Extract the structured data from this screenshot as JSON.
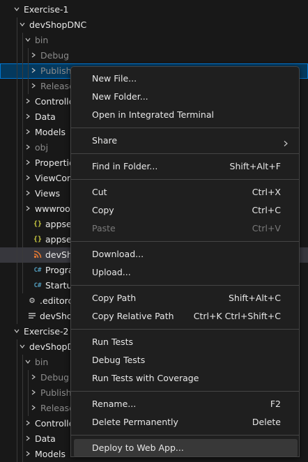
{
  "tree": {
    "rows": [
      {
        "label": "Exercise-1",
        "depth": 0,
        "chevron": "down",
        "style": "bright"
      },
      {
        "label": "devShopDNC",
        "depth": 1,
        "chevron": "down",
        "style": "bright"
      },
      {
        "label": "bin",
        "depth": 2,
        "chevron": "down",
        "style": "dim"
      },
      {
        "label": "Debug",
        "depth": 3,
        "chevron": "right",
        "style": "dim"
      },
      {
        "label": "Publish",
        "depth": 3,
        "chevron": "right",
        "style": "dim",
        "selected": true
      },
      {
        "label": "Release",
        "depth": 3,
        "chevron": "right",
        "style": "dim"
      },
      {
        "label": "Controllers",
        "depth": 2,
        "chevron": "right",
        "style": "bright"
      },
      {
        "label": "Data",
        "depth": 2,
        "chevron": "right",
        "style": "bright"
      },
      {
        "label": "Models",
        "depth": 2,
        "chevron": "right",
        "style": "bright"
      },
      {
        "label": "obj",
        "depth": 2,
        "chevron": "right",
        "style": "dim"
      },
      {
        "label": "Properties",
        "depth": 2,
        "chevron": "right",
        "style": "bright"
      },
      {
        "label": "ViewComponents",
        "depth": 2,
        "chevron": "right",
        "style": "bright"
      },
      {
        "label": "Views",
        "depth": 2,
        "chevron": "right",
        "style": "bright"
      },
      {
        "label": "wwwroot",
        "depth": 2,
        "chevron": "right",
        "style": "bright"
      },
      {
        "label": "appsettings.Development.json",
        "depth": 2,
        "icon": "json",
        "style": "bright"
      },
      {
        "label": "appsettings.json",
        "depth": 2,
        "icon": "json",
        "style": "bright"
      },
      {
        "label": "devShopDNC.csproj",
        "depth": 2,
        "icon": "rss",
        "style": "bright",
        "highlight": true
      },
      {
        "label": "Program.cs",
        "depth": 2,
        "icon": "csharp",
        "style": "bright"
      },
      {
        "label": "Startup.cs",
        "depth": 2,
        "icon": "csharp",
        "style": "bright"
      },
      {
        "label": ".editorconfig",
        "depth": 1,
        "icon": "gear",
        "style": "bright"
      },
      {
        "label": "devShopDNC.sln",
        "depth": 1,
        "icon": "lines",
        "style": "bright"
      },
      {
        "label": "Exercise-2",
        "depth": 0,
        "chevron": "down",
        "style": "bright"
      },
      {
        "label": "devShopDNC",
        "depth": 1,
        "chevron": "down",
        "style": "bright"
      },
      {
        "label": "bin",
        "depth": 2,
        "chevron": "down",
        "style": "dim"
      },
      {
        "label": "Debug",
        "depth": 3,
        "chevron": "right",
        "style": "dim"
      },
      {
        "label": "Publish",
        "depth": 3,
        "chevron": "right",
        "style": "dim"
      },
      {
        "label": "Release",
        "depth": 3,
        "chevron": "right",
        "style": "dim"
      },
      {
        "label": "Controllers",
        "depth": 2,
        "chevron": "right",
        "style": "bright"
      },
      {
        "label": "Data",
        "depth": 2,
        "chevron": "right",
        "style": "bright"
      },
      {
        "label": "Models",
        "depth": 2,
        "chevron": "right",
        "style": "bright"
      }
    ]
  },
  "context_menu": {
    "groups": [
      [
        {
          "label": "New File...",
          "shortcut": ""
        },
        {
          "label": "New Folder...",
          "shortcut": ""
        },
        {
          "label": "Open in Integrated Terminal",
          "shortcut": ""
        }
      ],
      [
        {
          "label": "Share",
          "shortcut": "",
          "submenu": true
        }
      ],
      [
        {
          "label": "Find in Folder...",
          "shortcut": "Shift+Alt+F"
        }
      ],
      [
        {
          "label": "Cut",
          "shortcut": "Ctrl+X"
        },
        {
          "label": "Copy",
          "shortcut": "Ctrl+C"
        },
        {
          "label": "Paste",
          "shortcut": "Ctrl+V",
          "disabled": true
        }
      ],
      [
        {
          "label": "Download...",
          "shortcut": ""
        },
        {
          "label": "Upload...",
          "shortcut": ""
        }
      ],
      [
        {
          "label": "Copy Path",
          "shortcut": "Shift+Alt+C"
        },
        {
          "label": "Copy Relative Path",
          "shortcut": "Ctrl+K Ctrl+Shift+C"
        }
      ],
      [
        {
          "label": "Run Tests",
          "shortcut": ""
        },
        {
          "label": "Debug Tests",
          "shortcut": ""
        },
        {
          "label": "Run Tests with Coverage",
          "shortcut": ""
        }
      ],
      [
        {
          "label": "Rename...",
          "shortcut": "F2"
        },
        {
          "label": "Delete Permanently",
          "shortcut": "Delete"
        }
      ],
      [
        {
          "label": "Deploy to Web App...",
          "shortcut": "",
          "active": true
        }
      ]
    ]
  },
  "colors": {
    "background": "#181818",
    "selection": "#04395e",
    "selection_border": "#0078d4",
    "json_icon": "#cbcb41",
    "rss_icon": "#e37933",
    "csharp_icon": "#519aba"
  }
}
